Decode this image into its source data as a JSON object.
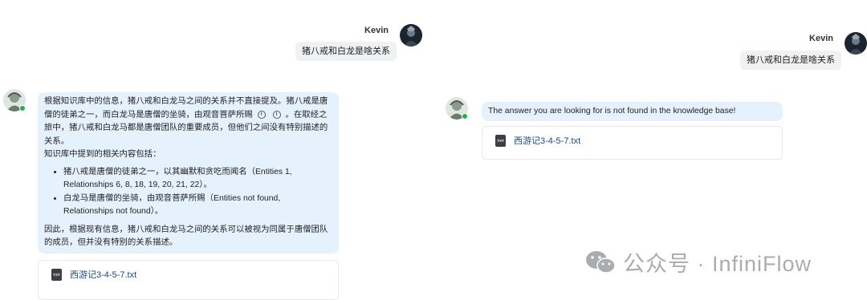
{
  "left": {
    "user": {
      "name": "Kevin",
      "question": "猪八戒和白龙是啥关系"
    },
    "answer": {
      "p1_a": "根据知识库中的信息，猪八戒和白龙马之间的关系并不直接提及。猪八戒是唐僧的徒弟之一，而白龙马是唐僧的坐骑，由观音菩萨所赐",
      "info_glyph": "i",
      "p1_b": "。在取经之旅中，猪八戒和白龙马都是唐僧团队的重要成员，但他们之间没有特别描述的关系。",
      "p2": "知识库中提到的相关内容包括：",
      "bullets": [
        "猪八戒是唐僧的徒弟之一，以其幽默和贪吃而闻名（Entities 1, Relationships 6, 8, 18, 19, 20, 21, 22）。",
        "白龙马是唐僧的坐骑，由观音菩萨所赐（Entities not found, Relationships not found）。"
      ],
      "p3": "因此，根据现有信息，猪八戒和白龙马之间的关系可以被视为同属于唐僧团队的成员，但并没有特别的关系描述。"
    },
    "source": {
      "file_icon": "TXT",
      "file_name": "西游记3-4-5-7.txt"
    }
  },
  "right": {
    "user": {
      "name": "Kevin",
      "question": "猪八戒和白龙是啥关系"
    },
    "answer": {
      "text": "The answer you are looking for is not found in the knowledge base!"
    },
    "source": {
      "file_icon": "TXT",
      "file_name": "西游记3-4-5-7.txt"
    }
  },
  "watermark": {
    "text": "公众号 · InfiniFlow",
    "icon": "wechat-icon"
  },
  "colors": {
    "ai_bubble": "#e5f1fd",
    "user_bubble": "#f0f1f3",
    "online": "#22b14c",
    "link": "#1a4a8a"
  }
}
